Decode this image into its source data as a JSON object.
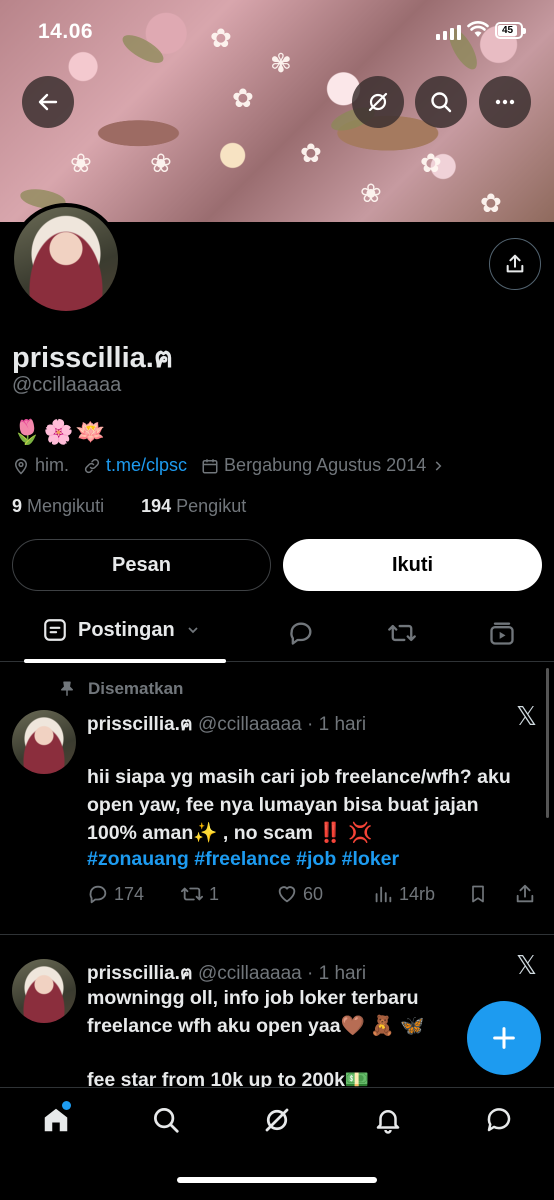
{
  "status": {
    "time": "14.06",
    "battery": "45"
  },
  "profile": {
    "display_name": "prisscillia.ฅ",
    "handle": "@ccillaaaaa",
    "bio": "🌷🌸🪷",
    "location": "him.",
    "link": "t.me/clpsc",
    "joined": "Bergabung Agustus 2014",
    "following_count": "9",
    "following_label": "Mengikuti",
    "followers_count": "194",
    "followers_label": "Pengikut"
  },
  "buttons": {
    "message": "Pesan",
    "follow": "Ikuti"
  },
  "tabs": {
    "posts": "Postingan"
  },
  "pinned_label": "Disematkan",
  "tweets": [
    {
      "name": "prisscillia.ฅ",
      "handle": "@ccillaaaaa",
      "time": "· 1 hari",
      "text": "hii siapa yg masih cari job freelance/wfh? aku open yaw, fee nya lumayan bisa buat jajan  100% aman✨ , no scam ‼️ 💢",
      "hashtags": "#zonauang #freelance #job #loker",
      "replies": "174",
      "retweets": "1",
      "likes": "60",
      "views": "14rb"
    },
    {
      "name": "prisscillia.ฅ",
      "handle": "@ccillaaaaa",
      "time": "· 1 hari",
      "text": "mowningg oll, info job loker terbaru freelance wfh aku open yaa🤎 🧸 🦋",
      "text2": "fee star from 10k up to 200k💵"
    }
  ],
  "icons": {
    "back": "arrow-left-icon",
    "grok": "grok-icon",
    "search": "search-icon",
    "more": "more-icon",
    "share": "share-icon",
    "x_logo": "x-logo-icon"
  },
  "colors": {
    "accent": "#1d9bf0",
    "background": "#000000",
    "muted": "#71767b"
  }
}
